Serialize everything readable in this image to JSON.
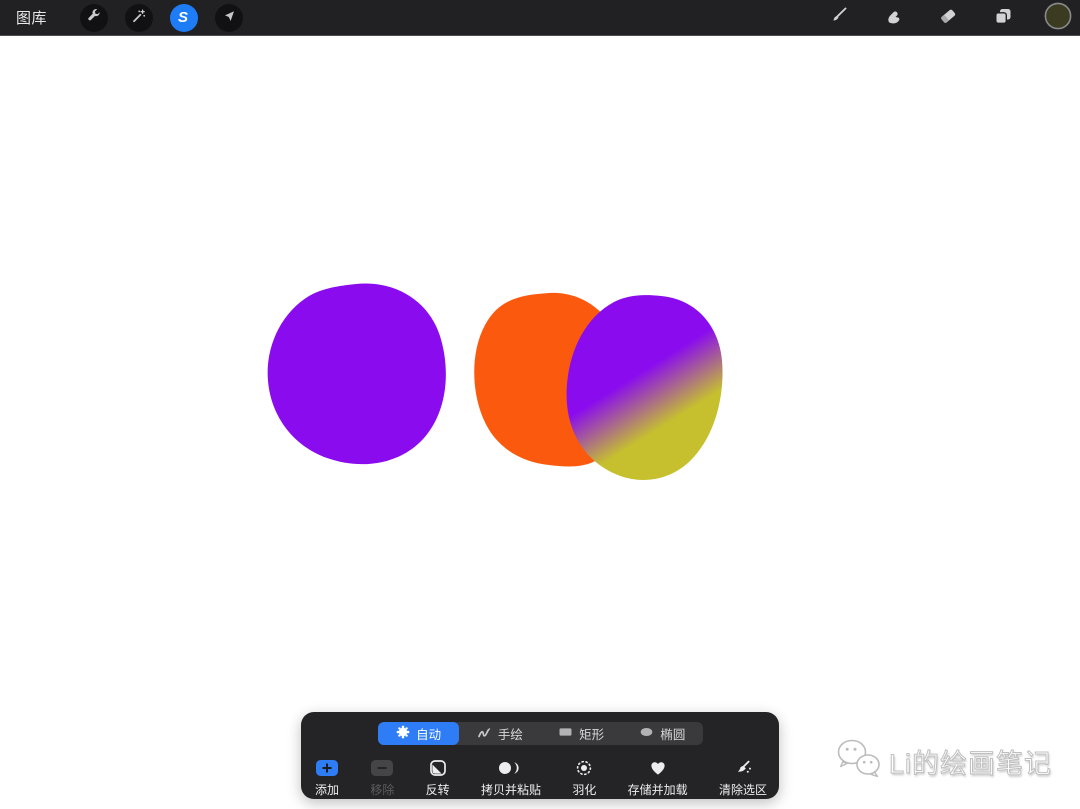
{
  "top_bar": {
    "gallery_label": "图库",
    "selection_glyph": "S",
    "tools_left": [
      {
        "id": "actions",
        "icon": "wrench-icon"
      },
      {
        "id": "adjustments",
        "icon": "magic-wand-icon"
      },
      {
        "id": "selection",
        "icon": "selection-s-icon",
        "active": true
      },
      {
        "id": "transform",
        "icon": "arrow-cursor-icon"
      }
    ],
    "tools_right": [
      {
        "id": "paint",
        "icon": "brush-icon"
      },
      {
        "id": "smudge",
        "icon": "smudge-finger-icon"
      },
      {
        "id": "erase",
        "icon": "eraser-icon"
      },
      {
        "id": "layers",
        "icon": "layers-icon"
      },
      {
        "id": "color",
        "icon": "color-swatch"
      }
    ],
    "color_swatch": "#3b3b21"
  },
  "canvas": {
    "background": "#ffffff",
    "blobs": [
      {
        "name": "purple-blob",
        "color": "#8a0cee"
      },
      {
        "name": "orange-blob",
        "color": "#fb5a0e"
      },
      {
        "name": "gradient-blob",
        "color_top": "#8a0cee",
        "color_bottom": "#c6c02f"
      }
    ]
  },
  "selection_panel": {
    "accent_color": "#2e7cf6",
    "modes": [
      {
        "label": "自动",
        "active": true
      },
      {
        "label": "手绘",
        "active": false
      },
      {
        "label": "矩形",
        "active": false
      },
      {
        "label": "椭圆",
        "active": false
      }
    ],
    "actions": [
      {
        "label": "添加",
        "state": "active"
      },
      {
        "label": "移除",
        "state": "disabled"
      },
      {
        "label": "反转",
        "state": "normal"
      },
      {
        "label": "拷贝并粘贴",
        "state": "normal"
      },
      {
        "label": "羽化",
        "state": "normal"
      },
      {
        "label": "存储并加载",
        "state": "normal"
      },
      {
        "label": "清除选区",
        "state": "normal"
      }
    ]
  },
  "watermark": {
    "text": "Li的绘画笔记"
  }
}
